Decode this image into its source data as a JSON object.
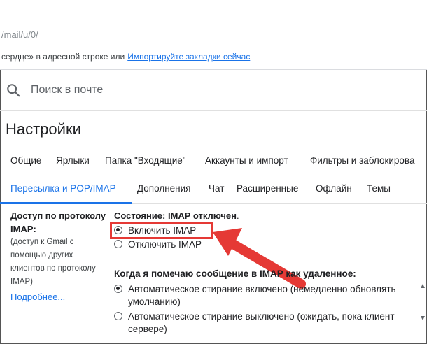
{
  "browser": {
    "url": "/mail/u/0/",
    "bookmark_bar_text": "сердце» в адресной строке или",
    "bookmark_bar_link": "Импортируйте закладки сейчас"
  },
  "search": {
    "placeholder": "Поиск в почте",
    "icon": "search-icon"
  },
  "settings": {
    "title": "Настройки",
    "tabs_row1": [
      "Общие",
      "Ярлыки",
      "Папка \"Входящие\"",
      "Аккаунты и импорт",
      "Фильтры и заблокирова"
    ],
    "tabs_row2": [
      "Пересылка и POP/IMAP",
      "Дополнения",
      "Чат",
      "Расширенные",
      "Офлайн",
      "Темы"
    ],
    "active_tab": "Пересылка и POP/IMAP"
  },
  "imap": {
    "section_label_1": "Доступ по протоколу",
    "section_label_2": "IMAP:",
    "section_desc": [
      "(доступ к Gmail с",
      "помощью других",
      "клиентов по протоколу",
      "IMAP)"
    ],
    "learn_more": "Подробнее...",
    "status_prefix": "Состояние: IMAP отключен",
    "status_suffix": ".",
    "enable_label": "Включить IMAP",
    "disable_label": "Отключить IMAP",
    "delete_title": "Когда я помечаю сообщение в IMAP как удаленное:",
    "auto_expunge_on_1": "Автоматическое стирание включено (немедленно обновлять",
    "auto_expunge_on_2": "умолчанию)",
    "auto_expunge_off_1": "Автоматическое стирание выключено (ожидать, пока клиент",
    "auto_expunge_off_2": "сервере)"
  },
  "colors": {
    "accent": "#1a73e8",
    "highlight": "#e53935"
  }
}
